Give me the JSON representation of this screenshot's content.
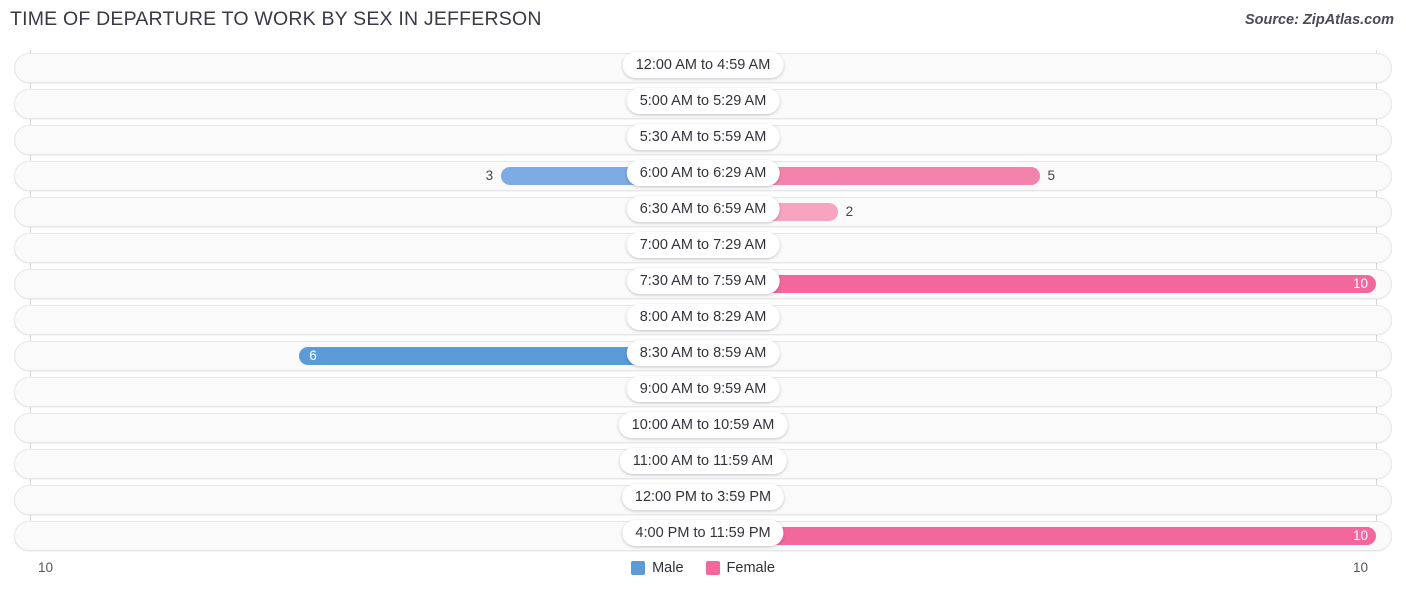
{
  "header": {
    "title": "TIME OF DEPARTURE TO WORK BY SEX IN JEFFERSON",
    "source": "Source: ZipAtlas.com"
  },
  "legend": {
    "male_label": "Male",
    "female_label": "Female",
    "male_color": "#5b9bd8",
    "female_color": "#f2689d"
  },
  "axis": {
    "left_tick": "10",
    "right_tick": "10"
  },
  "chart_data": {
    "type": "bar",
    "subtype": "diverging-bidirectional-bar",
    "title": "TIME OF DEPARTURE TO WORK BY SEX IN JEFFERSON",
    "xlabel": "",
    "ylabel": "",
    "xlim": [
      -10,
      10
    ],
    "axis_max": 10,
    "grid": true,
    "legend_position": "bottom-center",
    "categories": [
      "12:00 AM to 4:59 AM",
      "5:00 AM to 5:29 AM",
      "5:30 AM to 5:59 AM",
      "6:00 AM to 6:29 AM",
      "6:30 AM to 6:59 AM",
      "7:00 AM to 7:29 AM",
      "7:30 AM to 7:59 AM",
      "8:00 AM to 8:29 AM",
      "8:30 AM to 8:59 AM",
      "9:00 AM to 9:59 AM",
      "10:00 AM to 10:59 AM",
      "11:00 AM to 11:59 AM",
      "12:00 PM to 3:59 PM",
      "4:00 PM to 11:59 PM"
    ],
    "series": [
      {
        "name": "Male",
        "color": "#5b9bd8",
        "direction": "left",
        "values": [
          0,
          0,
          0,
          3,
          0,
          0,
          0,
          0,
          6,
          0,
          0,
          0,
          0,
          0
        ]
      },
      {
        "name": "Female",
        "color": "#f2689d",
        "direction": "right",
        "values": [
          0,
          0,
          0,
          5,
          2,
          0,
          10,
          0,
          0,
          0,
          0,
          0,
          0,
          10
        ]
      }
    ]
  },
  "rows": [
    {
      "label": "12:00 AM to 4:59 AM",
      "male": "0",
      "female": "0"
    },
    {
      "label": "5:00 AM to 5:29 AM",
      "male": "0",
      "female": "0"
    },
    {
      "label": "5:30 AM to 5:59 AM",
      "male": "0",
      "female": "0"
    },
    {
      "label": "6:00 AM to 6:29 AM",
      "male": "3",
      "female": "5"
    },
    {
      "label": "6:30 AM to 6:59 AM",
      "male": "0",
      "female": "2"
    },
    {
      "label": "7:00 AM to 7:29 AM",
      "male": "0",
      "female": "0"
    },
    {
      "label": "7:30 AM to 7:59 AM",
      "male": "0",
      "female": "10"
    },
    {
      "label": "8:00 AM to 8:29 AM",
      "male": "0",
      "female": "0"
    },
    {
      "label": "8:30 AM to 8:59 AM",
      "male": "6",
      "female": "0"
    },
    {
      "label": "9:00 AM to 9:59 AM",
      "male": "0",
      "female": "0"
    },
    {
      "label": "10:00 AM to 10:59 AM",
      "male": "0",
      "female": "0"
    },
    {
      "label": "11:00 AM to 11:59 AM",
      "male": "0",
      "female": "0"
    },
    {
      "label": "12:00 PM to 3:59 PM",
      "male": "0",
      "female": "0"
    },
    {
      "label": "4:00 PM to 11:59 PM",
      "male": "0",
      "female": "10"
    }
  ]
}
